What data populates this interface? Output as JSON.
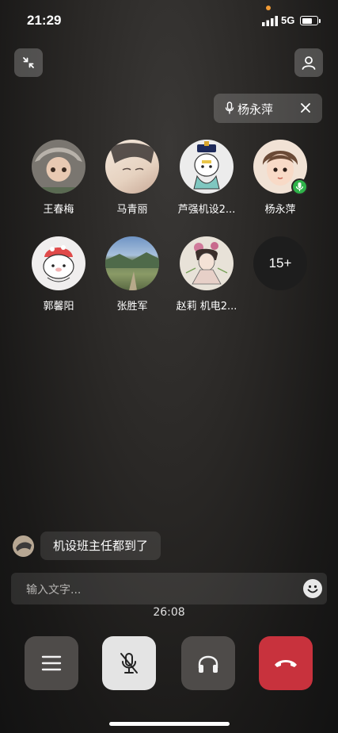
{
  "status_bar": {
    "time": "21:29",
    "network": "5G",
    "battery_level": 0.75
  },
  "header": {
    "minimize_icon": "shrink-arrows-icon",
    "profile_icon": "person-icon",
    "speaking": {
      "name": "杨永萍",
      "icon": "microphone-icon",
      "close_icon": "close-icon"
    }
  },
  "participants": [
    {
      "name": "王春梅",
      "avatar": "baby-photo"
    },
    {
      "name": "马青丽",
      "avatar": "portrait-photo"
    },
    {
      "name": "芦强机设2...",
      "avatar": "cartoon-official"
    },
    {
      "name": "杨永萍",
      "avatar": "cartoon-girl",
      "speaking": true
    },
    {
      "name": "郭馨阳",
      "avatar": "cartoon-cat"
    },
    {
      "name": "张胜军",
      "avatar": "landscape-photo"
    },
    {
      "name": "赵莉 机电2...",
      "avatar": "drawing-photo"
    }
  ],
  "more_participants": "15+",
  "chat": {
    "message": "机设班主任都到了"
  },
  "input": {
    "placeholder": "输入文字...",
    "emoji_icon": "smiley-icon"
  },
  "call_timer": "26:08",
  "controls": [
    {
      "name": "menu-button",
      "icon": "menu-icon"
    },
    {
      "name": "mute-button",
      "icon": "mic-muted-icon"
    },
    {
      "name": "speaker-button",
      "icon": "headphones-icon"
    },
    {
      "name": "hangup-button",
      "icon": "hangup-icon",
      "color": "#c8323d"
    }
  ]
}
